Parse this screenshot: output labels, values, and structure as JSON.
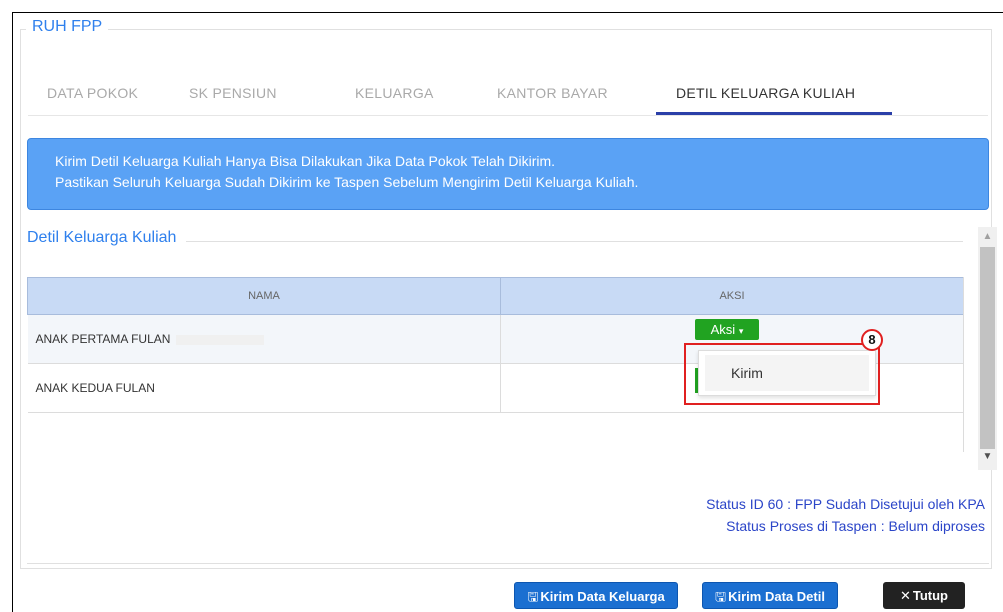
{
  "panel": {
    "legend": "RUH FPP"
  },
  "tabs": [
    {
      "label": "DATA POKOK"
    },
    {
      "label": "SK PENSIUN"
    },
    {
      "label": "KELUARGA"
    },
    {
      "label": "KANTOR BAYAR"
    },
    {
      "label": "DETIL KELUARGA KULIAH",
      "active": true
    }
  ],
  "alert": {
    "line1": "Kirim Detil Keluarga Kuliah Hanya Bisa Dilakukan Jika Data Pokok Telah Dikirim.",
    "line2": "Pastikan Seluruh Keluarga Sudah Dikirim ke Taspen Sebelum Mengirim Detil Keluarga Kuliah."
  },
  "section": {
    "title": "Detil Keluarga Kuliah"
  },
  "table": {
    "headers": {
      "nama": "NAMA",
      "aksi": "AKSI"
    },
    "rows": [
      {
        "nama": "ANAK PERTAMA FULAN"
      },
      {
        "nama": "ANAK KEDUA FULAN"
      }
    ]
  },
  "aksi_button": {
    "label": "Aksi",
    "caret": "▾"
  },
  "dropdown": {
    "items": [
      {
        "label": "Kirim"
      }
    ]
  },
  "annotation": {
    "step": "8",
    "color": "#e02020"
  },
  "status": {
    "line1": "Status ID 60 : FPP Sudah Disetujui oleh KPA",
    "line2": "Status Proses di Taspen : Belum diproses"
  },
  "footer": {
    "kirim_keluarga": "Kirim Data Keluarga",
    "kirim_detil": "Kirim Data Detil",
    "tutup": "Tutup",
    "save_icon": "🖫",
    "close_icon": "✕"
  },
  "colors": {
    "primary": "#2f80ed",
    "alert_bg": "#5aa2f5",
    "success": "#21a321",
    "button_blue": "#1b6fd1"
  }
}
